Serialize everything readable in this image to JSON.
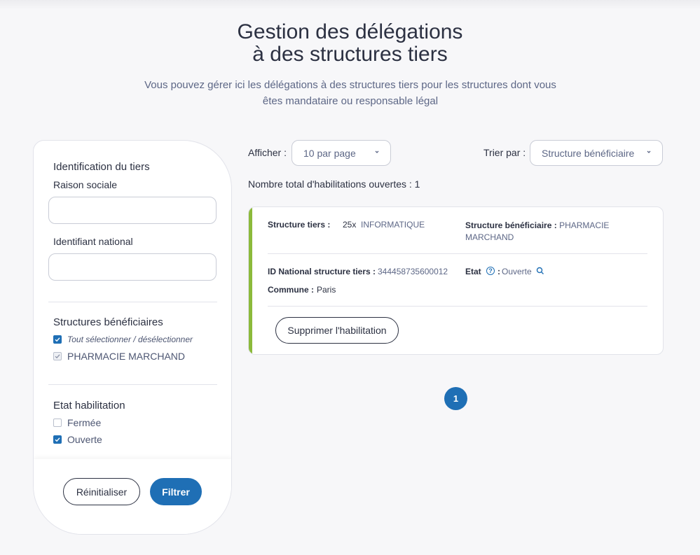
{
  "header": {
    "title_line1": "Gestion des délégations",
    "title_line2": "à des structures tiers",
    "subtitle_line1": "Vous pouvez gérer ici les délégations à des structures tiers pour les structures dont vous",
    "subtitle_line2": "êtes mandataire ou responsable légal"
  },
  "filters": {
    "identification_title": "Identification du tiers",
    "raison_sociale_label": "Raison sociale",
    "raison_sociale_value": "",
    "identifiant_label": "Identifiant national",
    "identifiant_value": "",
    "structures_title": "Structures bénéficiaires",
    "select_all_label": "Tout sélectionner / désélectionner",
    "structures": [
      {
        "label": "PHARMACIE MARCHAND",
        "checked": true,
        "disabled": true
      }
    ],
    "etat_title": "Etat habilitation",
    "etats": [
      {
        "label": "Fermée",
        "checked": false
      },
      {
        "label": "Ouverte",
        "checked": true
      }
    ],
    "reset_label": "Réinitialiser",
    "filter_label": "Filtrer"
  },
  "toolbar": {
    "show_label": "Afficher :",
    "page_size": "10 par page",
    "sort_label": "Trier par :",
    "sort_value": "Structure bénéficiaire",
    "total_text": "Nombre total d'habilitations ouvertes : 1"
  },
  "card": {
    "structure_tiers_key": "Structure tiers :",
    "structure_tiers_prefix": "25x",
    "structure_tiers_value": "INFORMATIQUE",
    "structure_benef_key": "Structure bénéficiaire :",
    "structure_benef_value_1": "PHARMACIE",
    "structure_benef_value_2": "MARCHAND",
    "id_key": "ID National structure tiers :",
    "id_value": "344458735600012",
    "etat_key": "Etat",
    "etat_sep": ":",
    "etat_value": "Ouverte",
    "commune_key": "Commune :",
    "commune_value": "Paris",
    "delete_label": "Supprimer l'habilitation",
    "accent_color": "#8cba3b"
  },
  "pagination": {
    "current": "1"
  },
  "colors": {
    "primary": "#1f6fb5",
    "text": "#2c3142",
    "muted": "#5d6786"
  }
}
